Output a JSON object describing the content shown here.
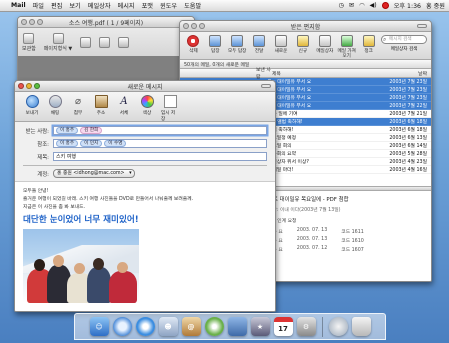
{
  "menubar": {
    "app": "Mail",
    "items": [
      "파일",
      "편집",
      "보기",
      "메일상자",
      "메시지",
      "포맷",
      "윈도우",
      "도움말"
    ],
    "clock": "오후 1:36",
    "user": "홍 중원"
  },
  "pdf_window": {
    "title": "소스 여행.pdf ( 1 / 9페이지)",
    "toolbar": [
      "보관함",
      "페이지형식 ▼",
      "",
      "",
      ""
    ]
  },
  "viewer": {
    "title": "받은 편지함",
    "toolbar": [
      "삭제",
      "답장",
      "모두 답장",
      "전달",
      "새로운",
      "신규",
      "메일상자",
      "메일 가져오기",
      "정크"
    ],
    "search_placeholder": "메시지 검색",
    "search_label": "메일상자 검색",
    "status": "50개의 메일, 0개의 새로운 메일",
    "columns": [
      "",
      "보낸 사람",
      "제목",
      "날짜"
    ],
    "messages": [
      {
        "subject": "Re: 대이밀유 무서 요",
        "date": "2003년 7월 23일",
        "selected": true
      },
      {
        "subject": "Re: 대이밀유 무서 요",
        "date": "2003년 7월 23일",
        "selected": true
      },
      {
        "subject": "Re: 대이밀유 무서 요",
        "date": "2003년 7월 23일",
        "selected": true
      },
      {
        "subject": "Re: 대이밀유 무서 요",
        "date": "2003년 7월 22일",
        "selected": true
      },
      {
        "subject": "오는 일에 기여",
        "date": "2003년 7월 21일",
        "selected": false
      },
      {
        "subject": "Re: 앨범 축하해!",
        "date": "2003년 6월 18일",
        "selected": true
      },
      {
        "subject": "앨범 축하해!",
        "date": "2003년 6월 18일",
        "selected": false
      },
      {
        "subject": "주요일정 예정",
        "date": "2003년 6월 13일",
        "selected": false
      },
      {
        "subject": "월요일 회의",
        "date": "2003년 6월 14일",
        "selected": false
      },
      {
        "subject": "회우회의 요약",
        "date": "2003년 5월 28일",
        "selected": false
      },
      {
        "subject": "메일상자 위서 이상?",
        "date": "2003년 4월 23일",
        "selected": false
      },
      {
        "subject": "이메일 마더!",
        "date": "2003년 4월 16일",
        "selected": false
      }
    ],
    "preview": {
      "title": "이트 대이밀유 목요일에 - PDF 첨합",
      "subtitle": "날짜: 이내 이다(2003년 7월 13일)",
      "line": "1/2 인계 요청",
      "rows": [
        {
          "name": "오우 요",
          "date": "2003. 07. 13",
          "size": "코드 1611"
        },
        {
          "name": "오우 요",
          "date": "2003. 07. 13",
          "size": "코드 1610"
        },
        {
          "name": "오우 요",
          "date": "2003. 07. 12",
          "size": "코드 1607"
        }
      ]
    }
  },
  "compose": {
    "title": "새로운 메시지",
    "toolbar": [
      "보내기",
      "채팅",
      "첨부",
      "주소",
      "서체",
      "색상",
      "임시 저장"
    ],
    "labels": {
      "to": "받는 사람:",
      "cc": "참조:",
      "subject": "제목:",
      "account": "계정:"
    },
    "to": [
      "이 홍주",
      "김 한희"
    ],
    "cc": [
      "이 홍주",
      "이 민지",
      "이 수명"
    ],
    "subject": "스키 여행",
    "account": "홍 중원 <idhong@mac.com>",
    "body": {
      "line1": "모두들 안녕!",
      "line2": "즐거운 여행이 되었길 바래. 스키 여행 사진들을 DVD로 만들어서 나눠줄께 보려줄께.",
      "line3": "지금은 이 사진을 좀 봐 보내드.",
      "headline": "대단한 눈이었어 너무 재미있어!"
    }
  },
  "dock": {
    "apps": [
      "finder",
      "mail",
      "safari",
      "ichat",
      "addressbook",
      "itunes",
      "iphoto",
      "imovie",
      "ical",
      "preferences",
      "trash"
    ],
    "ical_day": "17"
  },
  "colors": {
    "selection": "#3e7ed0",
    "headline": "#1f63c8"
  }
}
